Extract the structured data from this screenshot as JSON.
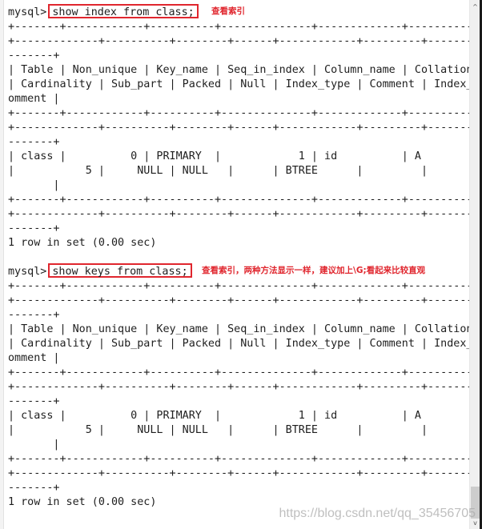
{
  "terminal": {
    "prompt": "mysql>",
    "blocks": [
      {
        "command": "show index from class;",
        "annotation": "查看索引",
        "lines": [
          "+-------+------------+----------+--------------+-------------+----------",
          "+-------------+----------+--------+------+------------+---------+--------",
          "-------+",
          "| Table | Non_unique | Key_name | Seq_in_index | Column_name | Collation",
          "| Cardinality | Sub_part | Packed | Null | Index_type | Comment | Index_c",
          "omment |",
          "+-------+------------+----------+--------------+-------------+----------",
          "+-------------+----------+--------+------+------------+---------+--------",
          "-------+",
          "| class |          0 | PRIMARY  |            1 | id          | A",
          "|           5 |     NULL | NULL   |      | BTREE      |         |",
          "       |",
          "+-------+------------+----------+--------------+-------------+----------",
          "+-------------+----------+--------+------+------------+---------+--------",
          "-------+",
          "1 row in set (0.00 sec)"
        ]
      },
      {
        "command": "show keys from class;",
        "annotation": "查看索引，两种方法显示一样，建议加上\\G;看起来比较直观",
        "lines": [
          "+-------+------------+----------+--------------+-------------+----------",
          "+-------------+----------+--------+------+------------+---------+--------",
          "-------+",
          "| Table | Non_unique | Key_name | Seq_in_index | Column_name | Collation",
          "| Cardinality | Sub_part | Packed | Null | Index_type | Comment | Index_c",
          "omment |",
          "+-------+------------+----------+--------------+-------------+----------",
          "+-------------+----------+--------+------+------------+---------+--------",
          "-------+",
          "| class |          0 | PRIMARY  |            1 | id          | A",
          "|           5 |     NULL | NULL   |      | BTREE      |         |",
          "       |",
          "+-------+------------+----------+--------------+-------------+----------",
          "+-------------+----------+--------+------+------------+---------+--------",
          "-------+",
          "1 row in set (0.00 sec)"
        ]
      }
    ]
  },
  "scrollbar": {
    "up_arrow": "^",
    "down_arrow": "v"
  },
  "watermark": "https://blog.csdn.net/qq_35456705",
  "colors": {
    "annotation": "#e0262e",
    "text": "#1e1e1e",
    "background": "#ffffff"
  }
}
